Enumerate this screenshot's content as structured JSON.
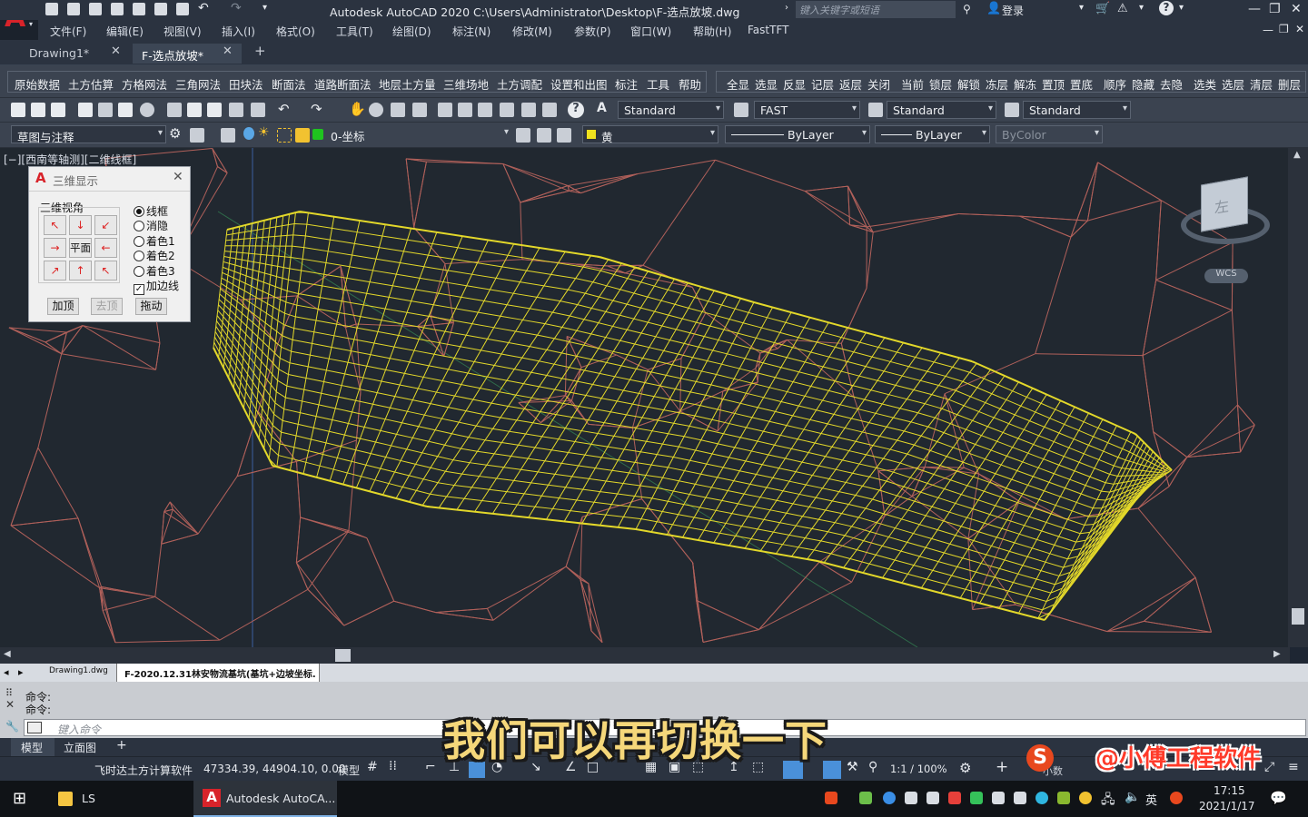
{
  "app": {
    "title": "Autodesk AutoCAD 2020    C:\\Users\\Administrator\\Desktop\\F-选点放坡.dwg",
    "search_placeholder": "键入关键字或短语",
    "login_label": "登录"
  },
  "menu": [
    "文件(F)",
    "编辑(E)",
    "视图(V)",
    "插入(I)",
    "格式(O)",
    "工具(T)",
    "绘图(D)",
    "标注(N)",
    "修改(M)",
    "参数(P)",
    "窗口(W)",
    "帮助(H)",
    "FastTFT"
  ],
  "doc_tabs": [
    {
      "label": "Drawing1*",
      "active": false
    },
    {
      "label": "F-选点放坡*",
      "active": true
    }
  ],
  "plugin_toolbar": {
    "left": [
      "原始数据",
      "土方估算",
      "方格网法",
      "三角网法",
      "田块法",
      "断面法",
      "道路断面法",
      "地层土方量",
      "三维场地",
      "土方调配",
      "设置和出图",
      "标注",
      "工具",
      "帮助"
    ],
    "right": [
      "全显",
      "选显",
      "反显",
      "记层",
      "返层",
      "关闭",
      "当前",
      "锁层",
      "解锁",
      "冻层",
      "解冻",
      "置顶",
      "置底",
      "顺序",
      "隐藏",
      "去隐",
      "选类",
      "选层",
      "清层",
      "删层"
    ]
  },
  "style_toolbar": {
    "text_style": "Standard",
    "dim_style": "FAST",
    "table_style": "Standard",
    "mleader_style": "Standard"
  },
  "layer_toolbar": {
    "workspace": "草图与注释",
    "layer": "0-坐标",
    "color": "黄",
    "linetype": "ByLayer",
    "lineweight": "ByLayer",
    "plotstyle": "ByColor"
  },
  "viewport_label": "[−][西南等轴测][二维线框]",
  "viewcube": {
    "face_label": "左",
    "wcs_label": "WCS"
  },
  "dialog": {
    "title": "三维显示",
    "group_label": "三维视角",
    "center_button": "平面",
    "options": [
      {
        "label": "线框",
        "selected": true
      },
      {
        "label": "消隐",
        "selected": false
      },
      {
        "label": "着色1",
        "selected": false
      },
      {
        "label": "着色2",
        "selected": false
      },
      {
        "label": "着色3",
        "selected": false
      }
    ],
    "checkbox": {
      "label": "加边线",
      "checked": true
    },
    "buttons": [
      {
        "label": "加顶",
        "enabled": true
      },
      {
        "label": "去顶",
        "enabled": false
      },
      {
        "label": "拖动",
        "enabled": true
      }
    ]
  },
  "layout_file_tabs": [
    "Drawing1.dwg",
    "F-2020.12.31林安物流基坑(基坑+边坡坐标..."
  ],
  "command": {
    "history": [
      "命令:",
      "命令:"
    ],
    "input_placeholder": "键入命令"
  },
  "model_tabs": [
    "模型",
    "立面图"
  ],
  "status": {
    "app_name": "飞时达土方计算软件",
    "coordinates": "47334.39, 44904.10, 0.00",
    "mode": "模型",
    "scale": "1:1 / 100%",
    "units": "小数"
  },
  "subtitle": "我们可以再切换一下",
  "watermark": "@小傅工程软件",
  "taskbar": {
    "items": [
      "LS",
      "Autodesk AutoCA..."
    ],
    "ime": "英",
    "time": "17:15",
    "date": "2021/1/17"
  },
  "colors": {
    "accent_red": "#d8232a",
    "tin_lines": "#b0605a",
    "wireframe": "#e3d82a",
    "canvas_bg": "#212830"
  }
}
